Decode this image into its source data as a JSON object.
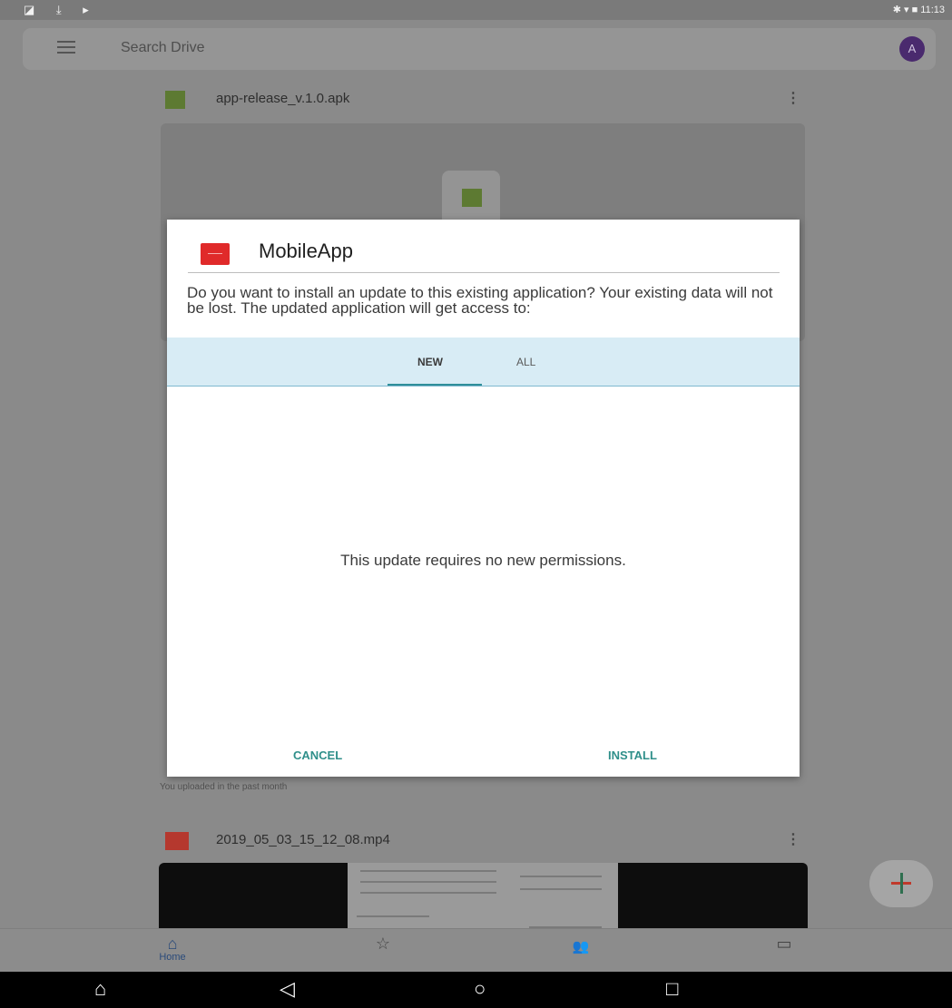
{
  "status_bar": {
    "left_icons": "◪ ⤓ ▸",
    "right": "✱ ▾ ■ 11:13"
  },
  "search": {
    "placeholder": "Search Drive",
    "avatar_letter": "A"
  },
  "files": [
    {
      "name": "app-release_v.1.0.apk",
      "icon": "apk-icon"
    },
    {
      "name": "2019_05_03_15_12_08.mp4",
      "icon": "video-icon"
    }
  ],
  "uploaded_note": "You uploaded in the past month",
  "dialog": {
    "app_name": "MobileApp",
    "message": "Do you want to install an update to this existing application? Your existing data will not be lost. The updated application will get access to:",
    "tabs": [
      "NEW",
      "ALL"
    ],
    "selected_tab": "NEW",
    "permissions_text": "This update requires no new permissions.",
    "cancel": "CANCEL",
    "install": "INSTALL"
  },
  "bottom_nav": {
    "home_label": "Home",
    "home_icon": "⌂",
    "starred_icon": "☆",
    "shared_icon": "👥",
    "files_icon": "▭"
  },
  "system_nav": {
    "recents_left": "⌂",
    "back": "◁",
    "home": "○",
    "recents": "□"
  },
  "colors": {
    "accent": "#2f8f8a",
    "app_icon": "#e02a2a",
    "tab_bar": "#d8ecf5"
  }
}
